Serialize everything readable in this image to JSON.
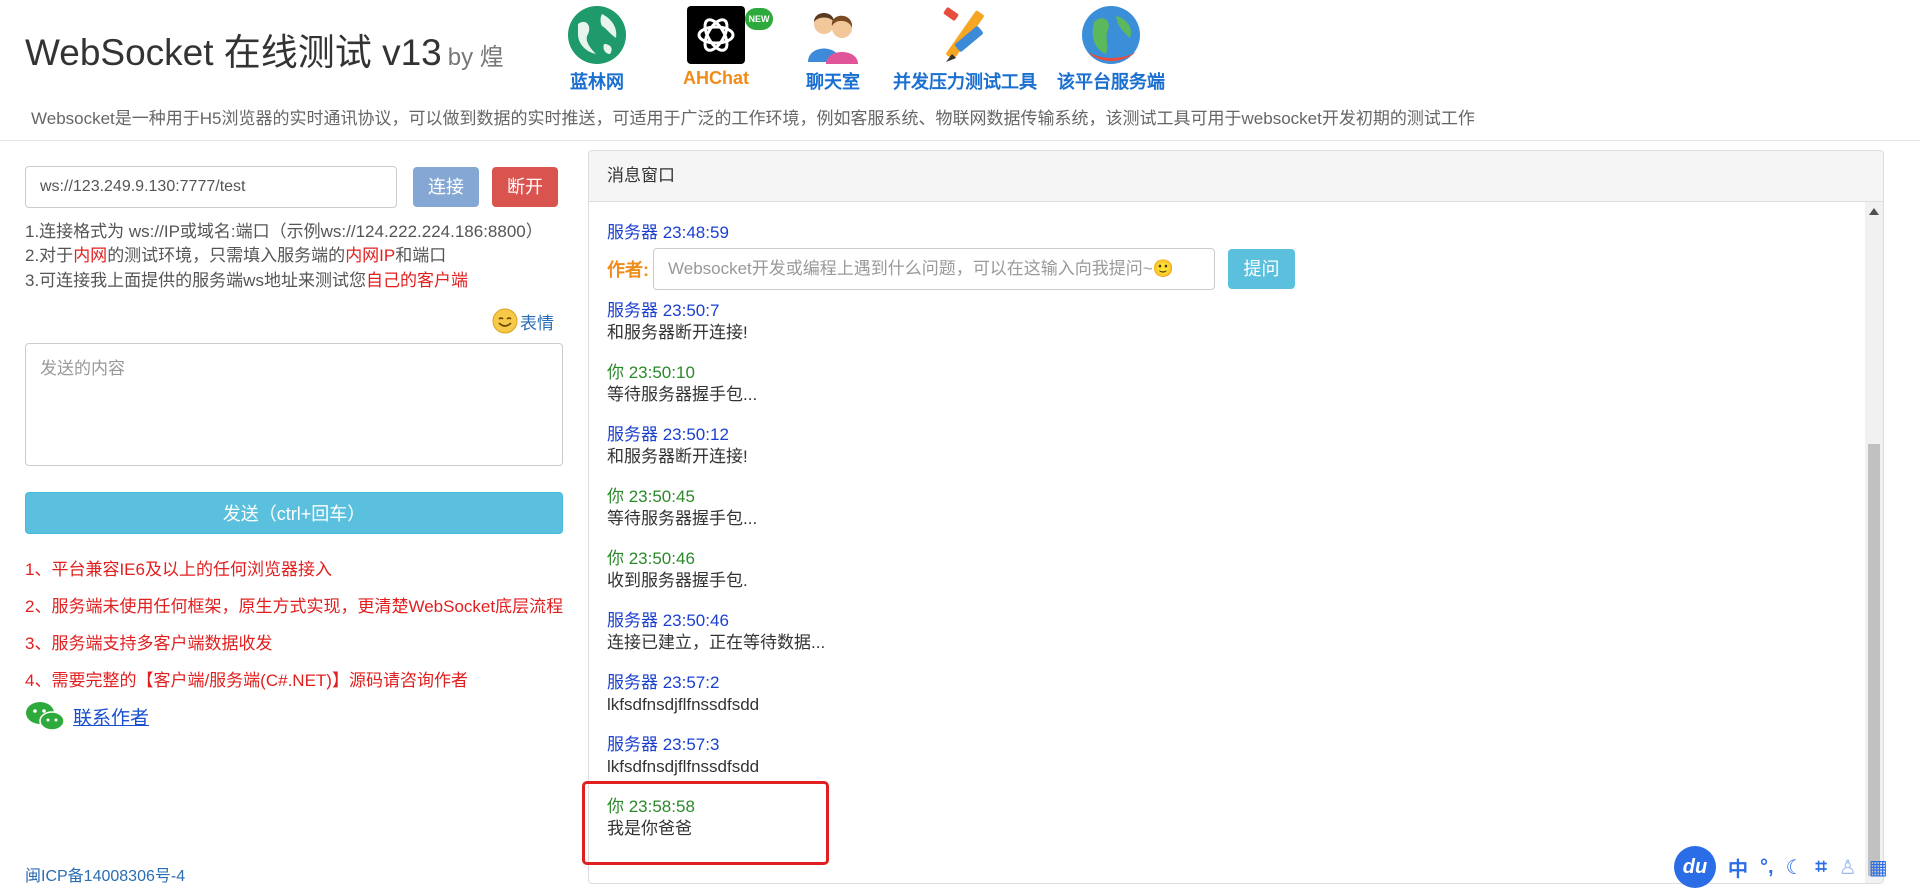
{
  "header": {
    "title": "WebSocket 在线测试 v13",
    "by": "by 煌",
    "nav": [
      {
        "label": "蓝林网",
        "icon": "globe-icon"
      },
      {
        "label": "AHChat",
        "icon": "openai-icon",
        "badge": "NEW"
      },
      {
        "label": "聊天室",
        "icon": "people-icon"
      },
      {
        "label": "并发压力测试工具",
        "icon": "tools-icon"
      },
      {
        "label": "该平台服务端",
        "icon": "earth-icon"
      }
    ],
    "description": "Websocket是一种用于H5浏览器的实时通讯协议，可以做到数据的实时推送，可适用于广泛的工作环境，例如客服系统、物联网数据传输系统，该测试工具可用于websocket开发初期的测试工作"
  },
  "connection": {
    "url": "ws://123.249.9.130:7777/test",
    "connect_label": "连接",
    "disconnect_label": "断开"
  },
  "help": {
    "line1": "1.连接格式为 ws://IP或域名:端口（示例ws://124.222.224.186:8800）",
    "line2_a": "2.对于",
    "line2_b": "内网",
    "line2_c": "的测试环境，只需填入服务端的",
    "line2_d": "内网IP",
    "line2_e": "和端口",
    "line3_a": "3.可连接我上面提供的服务端ws地址来测试您",
    "line3_b": "自己的客户端"
  },
  "emoji_label": "表情",
  "send": {
    "placeholder": "发送的内容",
    "button_label": "发送（ctrl+回车）"
  },
  "notes": [
    "1、平台兼容IE6及以上的任何浏览器接入",
    "2、服务端未使用任何框架，原生方式实现，更清楚WebSocket底层流程",
    "3、服务端支持多客户端数据收发",
    "4、需要完整的【客户端/服务端(C#.NET)】源码请咨询作者"
  ],
  "contact_label": "联系作者",
  "icp": "闽ICP备14008306号-4",
  "panel": {
    "title": "消息窗口",
    "author_label": "作者:",
    "ask_placeholder": "Websocket开发或编程上遇到什么问题，可以在这输入向我提问~🙂",
    "ask_button": "提问",
    "messages": [
      {
        "type": "server",
        "header": "服务器 23:48:59",
        "body": ""
      },
      {
        "type": "server",
        "header": "服务器 23:50:7",
        "body": "和服务器断开连接!"
      },
      {
        "type": "you",
        "header": "你 23:50:10",
        "body": "等待服务器握手包..."
      },
      {
        "type": "server",
        "header": "服务器 23:50:12",
        "body": "和服务器断开连接!"
      },
      {
        "type": "you",
        "header": "你 23:50:45",
        "body": "等待服务器握手包..."
      },
      {
        "type": "you",
        "header": "你 23:50:46",
        "body": "收到服务器握手包."
      },
      {
        "type": "server",
        "header": "服务器 23:50:46",
        "body": "连接已建立，正在等待数据..."
      },
      {
        "type": "server",
        "header": "服务器 23:57:2",
        "body": "lkfsdfnsdjflfnssdfsdd"
      },
      {
        "type": "server",
        "header": "服务器 23:57:3",
        "body": "lkfsdfnsdjflfnssdfsdd"
      },
      {
        "type": "you",
        "header": "你 23:58:58",
        "body": "我是你爸爸"
      }
    ]
  },
  "ime": {
    "logo": "du",
    "items": [
      "中"
    ]
  }
}
